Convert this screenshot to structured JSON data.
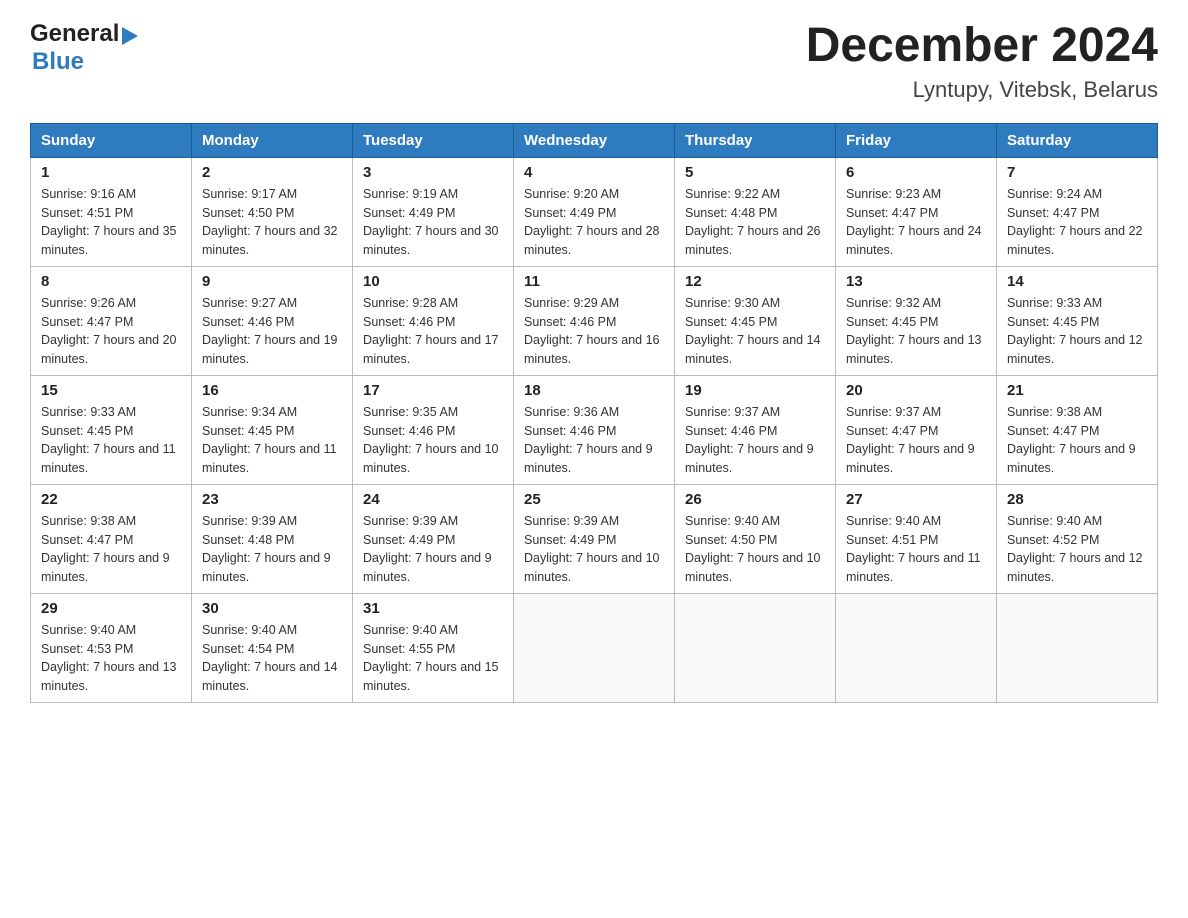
{
  "logo": {
    "text_general": "General",
    "text_blue": "Blue",
    "alt": "GeneralBlue Logo"
  },
  "title": "December 2024",
  "subtitle": "Lyntupy, Vitebsk, Belarus",
  "weekdays": [
    "Sunday",
    "Monday",
    "Tuesday",
    "Wednesday",
    "Thursday",
    "Friday",
    "Saturday"
  ],
  "weeks": [
    [
      {
        "day": "1",
        "sunrise": "Sunrise: 9:16 AM",
        "sunset": "Sunset: 4:51 PM",
        "daylight": "Daylight: 7 hours and 35 minutes."
      },
      {
        "day": "2",
        "sunrise": "Sunrise: 9:17 AM",
        "sunset": "Sunset: 4:50 PM",
        "daylight": "Daylight: 7 hours and 32 minutes."
      },
      {
        "day": "3",
        "sunrise": "Sunrise: 9:19 AM",
        "sunset": "Sunset: 4:49 PM",
        "daylight": "Daylight: 7 hours and 30 minutes."
      },
      {
        "day": "4",
        "sunrise": "Sunrise: 9:20 AM",
        "sunset": "Sunset: 4:49 PM",
        "daylight": "Daylight: 7 hours and 28 minutes."
      },
      {
        "day": "5",
        "sunrise": "Sunrise: 9:22 AM",
        "sunset": "Sunset: 4:48 PM",
        "daylight": "Daylight: 7 hours and 26 minutes."
      },
      {
        "day": "6",
        "sunrise": "Sunrise: 9:23 AM",
        "sunset": "Sunset: 4:47 PM",
        "daylight": "Daylight: 7 hours and 24 minutes."
      },
      {
        "day": "7",
        "sunrise": "Sunrise: 9:24 AM",
        "sunset": "Sunset: 4:47 PM",
        "daylight": "Daylight: 7 hours and 22 minutes."
      }
    ],
    [
      {
        "day": "8",
        "sunrise": "Sunrise: 9:26 AM",
        "sunset": "Sunset: 4:47 PM",
        "daylight": "Daylight: 7 hours and 20 minutes."
      },
      {
        "day": "9",
        "sunrise": "Sunrise: 9:27 AM",
        "sunset": "Sunset: 4:46 PM",
        "daylight": "Daylight: 7 hours and 19 minutes."
      },
      {
        "day": "10",
        "sunrise": "Sunrise: 9:28 AM",
        "sunset": "Sunset: 4:46 PM",
        "daylight": "Daylight: 7 hours and 17 minutes."
      },
      {
        "day": "11",
        "sunrise": "Sunrise: 9:29 AM",
        "sunset": "Sunset: 4:46 PM",
        "daylight": "Daylight: 7 hours and 16 minutes."
      },
      {
        "day": "12",
        "sunrise": "Sunrise: 9:30 AM",
        "sunset": "Sunset: 4:45 PM",
        "daylight": "Daylight: 7 hours and 14 minutes."
      },
      {
        "day": "13",
        "sunrise": "Sunrise: 9:32 AM",
        "sunset": "Sunset: 4:45 PM",
        "daylight": "Daylight: 7 hours and 13 minutes."
      },
      {
        "day": "14",
        "sunrise": "Sunrise: 9:33 AM",
        "sunset": "Sunset: 4:45 PM",
        "daylight": "Daylight: 7 hours and 12 minutes."
      }
    ],
    [
      {
        "day": "15",
        "sunrise": "Sunrise: 9:33 AM",
        "sunset": "Sunset: 4:45 PM",
        "daylight": "Daylight: 7 hours and 11 minutes."
      },
      {
        "day": "16",
        "sunrise": "Sunrise: 9:34 AM",
        "sunset": "Sunset: 4:45 PM",
        "daylight": "Daylight: 7 hours and 11 minutes."
      },
      {
        "day": "17",
        "sunrise": "Sunrise: 9:35 AM",
        "sunset": "Sunset: 4:46 PM",
        "daylight": "Daylight: 7 hours and 10 minutes."
      },
      {
        "day": "18",
        "sunrise": "Sunrise: 9:36 AM",
        "sunset": "Sunset: 4:46 PM",
        "daylight": "Daylight: 7 hours and 9 minutes."
      },
      {
        "day": "19",
        "sunrise": "Sunrise: 9:37 AM",
        "sunset": "Sunset: 4:46 PM",
        "daylight": "Daylight: 7 hours and 9 minutes."
      },
      {
        "day": "20",
        "sunrise": "Sunrise: 9:37 AM",
        "sunset": "Sunset: 4:47 PM",
        "daylight": "Daylight: 7 hours and 9 minutes."
      },
      {
        "day": "21",
        "sunrise": "Sunrise: 9:38 AM",
        "sunset": "Sunset: 4:47 PM",
        "daylight": "Daylight: 7 hours and 9 minutes."
      }
    ],
    [
      {
        "day": "22",
        "sunrise": "Sunrise: 9:38 AM",
        "sunset": "Sunset: 4:47 PM",
        "daylight": "Daylight: 7 hours and 9 minutes."
      },
      {
        "day": "23",
        "sunrise": "Sunrise: 9:39 AM",
        "sunset": "Sunset: 4:48 PM",
        "daylight": "Daylight: 7 hours and 9 minutes."
      },
      {
        "day": "24",
        "sunrise": "Sunrise: 9:39 AM",
        "sunset": "Sunset: 4:49 PM",
        "daylight": "Daylight: 7 hours and 9 minutes."
      },
      {
        "day": "25",
        "sunrise": "Sunrise: 9:39 AM",
        "sunset": "Sunset: 4:49 PM",
        "daylight": "Daylight: 7 hours and 10 minutes."
      },
      {
        "day": "26",
        "sunrise": "Sunrise: 9:40 AM",
        "sunset": "Sunset: 4:50 PM",
        "daylight": "Daylight: 7 hours and 10 minutes."
      },
      {
        "day": "27",
        "sunrise": "Sunrise: 9:40 AM",
        "sunset": "Sunset: 4:51 PM",
        "daylight": "Daylight: 7 hours and 11 minutes."
      },
      {
        "day": "28",
        "sunrise": "Sunrise: 9:40 AM",
        "sunset": "Sunset: 4:52 PM",
        "daylight": "Daylight: 7 hours and 12 minutes."
      }
    ],
    [
      {
        "day": "29",
        "sunrise": "Sunrise: 9:40 AM",
        "sunset": "Sunset: 4:53 PM",
        "daylight": "Daylight: 7 hours and 13 minutes."
      },
      {
        "day": "30",
        "sunrise": "Sunrise: 9:40 AM",
        "sunset": "Sunset: 4:54 PM",
        "daylight": "Daylight: 7 hours and 14 minutes."
      },
      {
        "day": "31",
        "sunrise": "Sunrise: 9:40 AM",
        "sunset": "Sunset: 4:55 PM",
        "daylight": "Daylight: 7 hours and 15 minutes."
      },
      null,
      null,
      null,
      null
    ]
  ]
}
